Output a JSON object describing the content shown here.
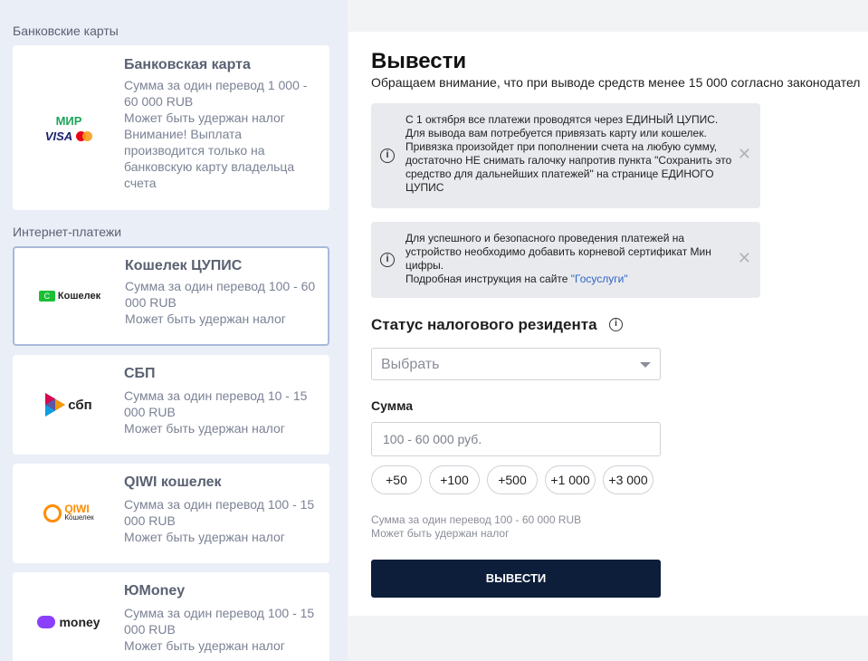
{
  "sections": {
    "bank": "Банковские карты",
    "internet": "Интернет-платежи"
  },
  "methods": [
    {
      "title": "Банковская карта",
      "desc": "Сумма за один перевод 1 000 -\n60 000 RUB\nМожет быть удержан налог\nВнимание! Выплата производится только на банковскую карту владельца счета",
      "logo": {
        "top": "МИР",
        "bottom": "VISA"
      }
    },
    {
      "title": "Кошелек ЦУПИС",
      "desc": "Сумма за один перевод 100 - 60 000 RUB\nМожет быть удержан налог",
      "logo": {
        "text": "Кошелек"
      }
    },
    {
      "title": "СБП",
      "desc": "Сумма за один перевод 10 - 15 000 RUB\nМожет быть удержан налог",
      "logo": {
        "text": "сбп"
      }
    },
    {
      "title": "QIWI кошелек",
      "desc": "Сумма за один перевод 100 - 15 000 RUB\nМожет быть удержан налог",
      "logo": {
        "text": "QIWI",
        "sub": "Кошелек"
      }
    },
    {
      "title": "ЮMoney",
      "desc": "Сумма за один перевод 100 - 15 000 RUB\nМожет быть удержан налог",
      "logo": {
        "text": "money"
      }
    }
  ],
  "withdraw": {
    "heading": "Вывести",
    "notice": "Обращаем внимание, что при выводе средств менее 15 000 согласно законодател",
    "alert1": "С 1 октября все платежи проводятся через ЕДИНЫЙ ЦУПИС. Для вывода вам потребуется привязать карту или кошелек. Привязка произойдет при пополнении счета на любую сумму, достаточно НЕ снимать галочку напротив пункта \"Сохранить это средство для дальнейших платежей\" на странице ЕДИНОГО ЦУПИС",
    "alert2_text": "Для успешного и безопасного проведения платежей на устройство необходимо добавить корневой сертификат Мин цифры.",
    "alert2_instr": "Подробная инструкция на сайте ",
    "alert2_link": "\"Госуслуги\"",
    "close_glyph": "✕",
    "tax_label": "Статус налогового резидента",
    "select_placeholder": "Выбрать",
    "amount_label": "Сумма",
    "amount_placeholder": "100 - 60 000 руб.",
    "chips": [
      "+50",
      "+100",
      "+500",
      "+1 000",
      "+3 000"
    ],
    "hint_line1": "Сумма за один перевод 100 - 60 000 RUB",
    "hint_line2": "Может быть удержан налог",
    "submit": "ВЫВЕСТИ"
  }
}
